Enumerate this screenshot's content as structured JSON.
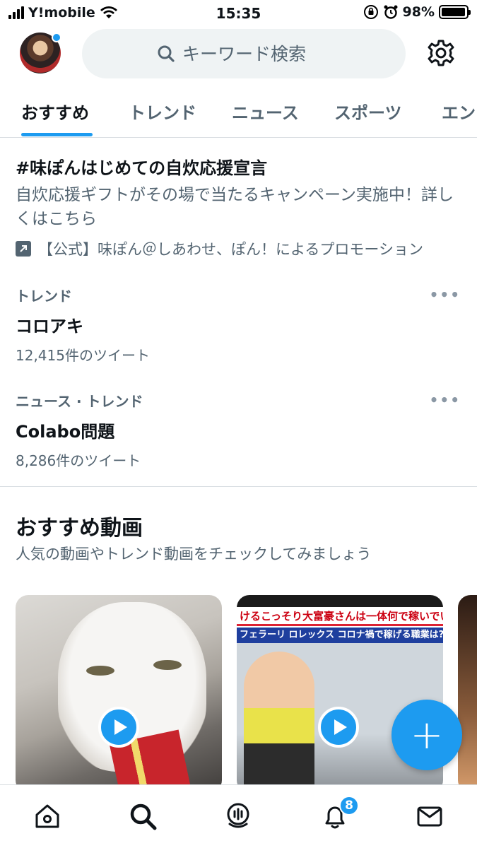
{
  "status_bar": {
    "carrier": "Y!mobile",
    "time": "15:35",
    "battery": "98%",
    "battery_level": 0.98
  },
  "header": {
    "search_placeholder": "キーワード検索"
  },
  "tabs": [
    {
      "label": "おすすめ",
      "active": true
    },
    {
      "label": "トレンド",
      "active": false
    },
    {
      "label": "ニュース",
      "active": false
    },
    {
      "label": "スポーツ",
      "active": false
    },
    {
      "label": "エン",
      "active": false
    }
  ],
  "promo": {
    "title": "#味ぽんはじめての自炊応援宣言",
    "description": "自炊応援ギフトがその場で当たるキャンペーン実施中！詳しくはこちら",
    "by": "【公式】味ぽん＠しあわせ、ぽん！によるプロモーション"
  },
  "trends": [
    {
      "category": "トレンド",
      "name": "コロアキ",
      "count": "12,415件のツイート"
    },
    {
      "category": "ニュース · トレンド",
      "name": "Colabo問題",
      "count": "8,286件のツイート"
    }
  ],
  "videos_section": {
    "title": "おすすめ動画",
    "subtitle": "人気の動画やトレンド動画をチェックしてみましょう",
    "video2_banner1": "けるこっそり大富豪さんは一体何で稼いでいる",
    "video2_banner2": "フェラーリ ロレックス コロナ禍で稼げる職業は??"
  },
  "fab_label": "+",
  "bottom_nav": {
    "notifications_badge": "8"
  },
  "colors": {
    "accent": "#1d9bf0",
    "text_primary": "#0f1419",
    "text_secondary": "#536471"
  },
  "icons": [
    "search-icon",
    "gear-icon",
    "home-icon",
    "spaces-icon",
    "bell-icon",
    "mail-icon",
    "play-icon",
    "external-link-icon",
    "more-icon"
  ]
}
